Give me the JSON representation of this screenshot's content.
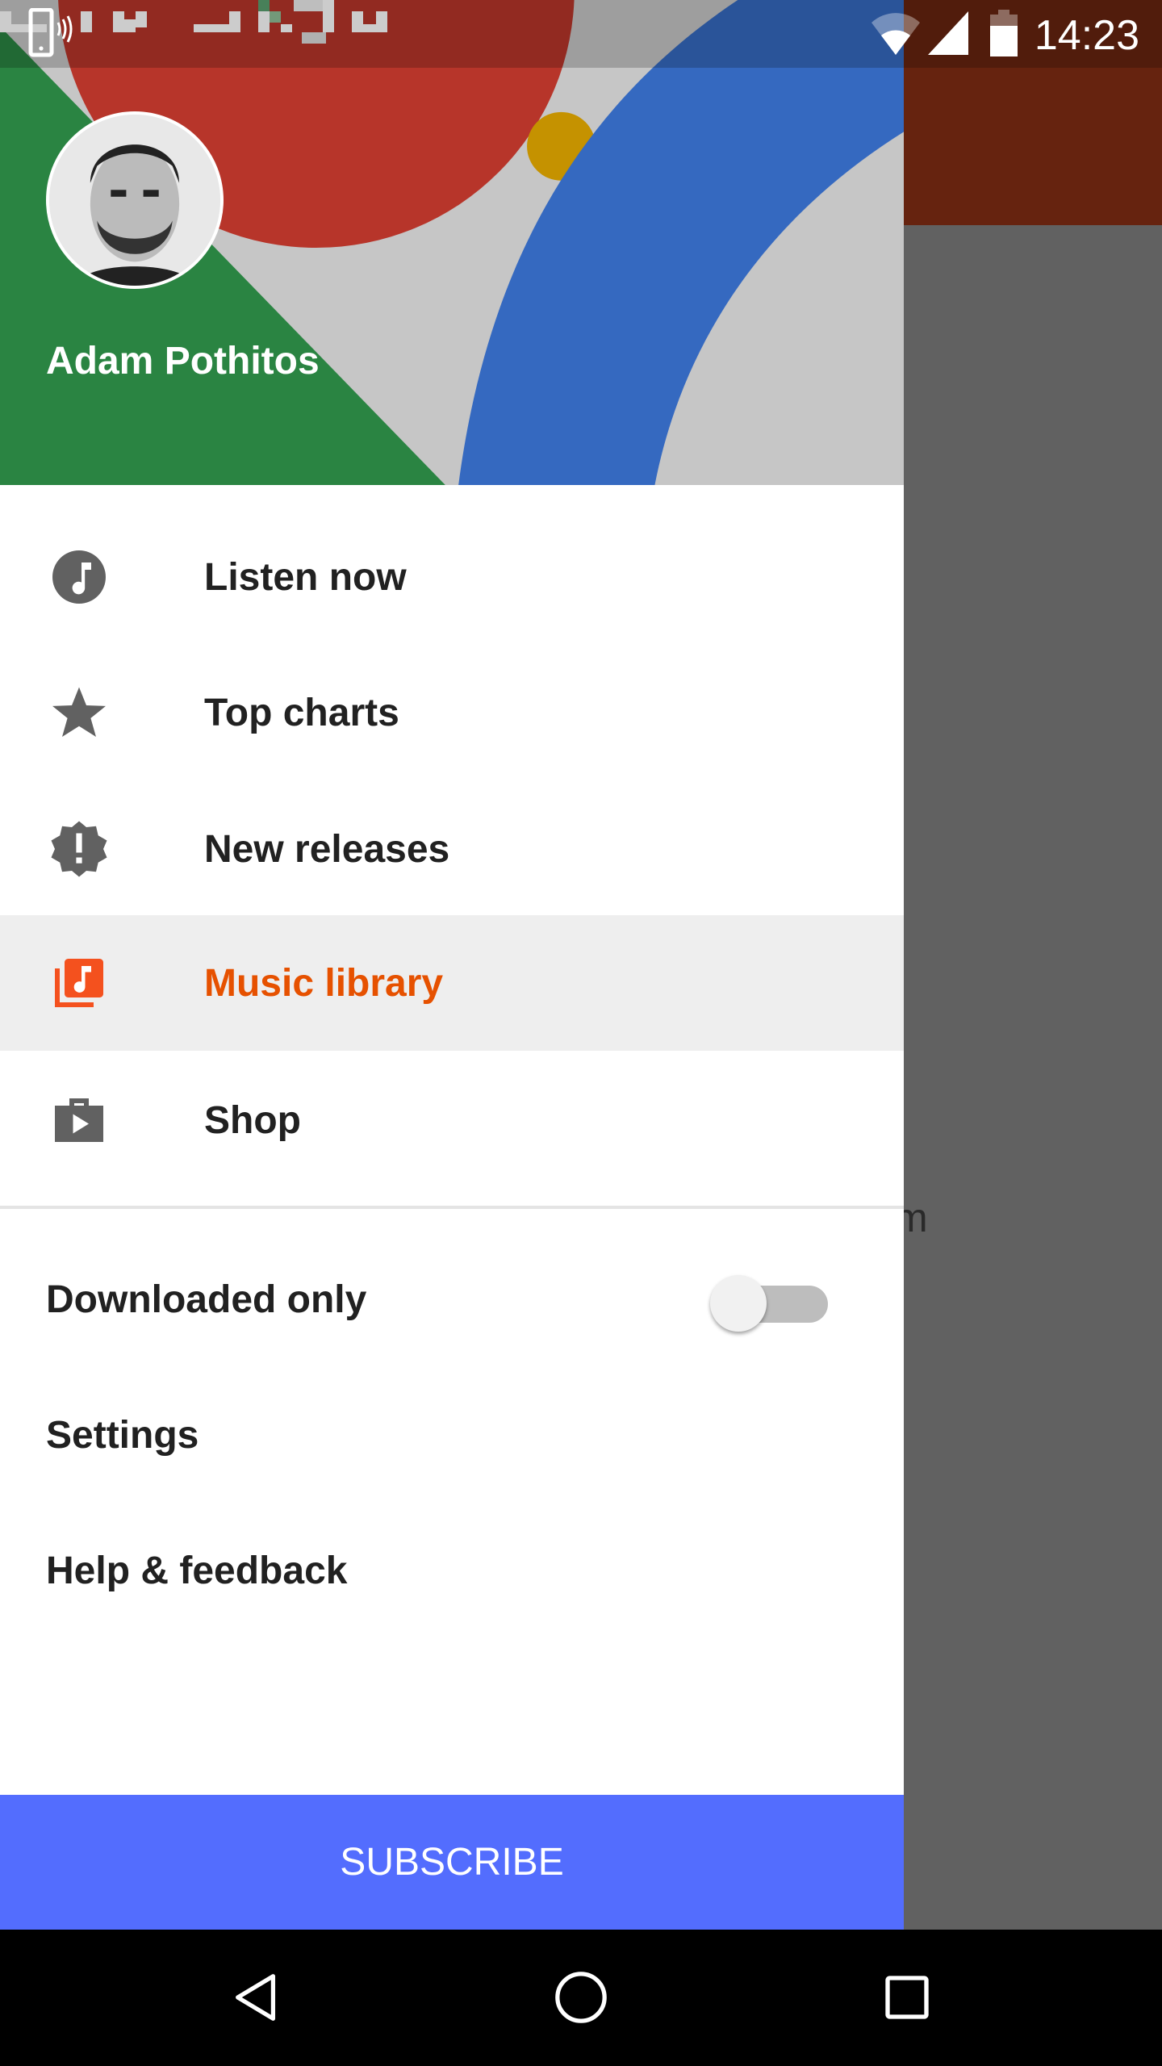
{
  "status_bar": {
    "time": "14:23",
    "icons": [
      "vibrate-phone-icon",
      "wifi-icon",
      "cell-signal-icon",
      "battery-icon"
    ]
  },
  "drawer": {
    "user": {
      "name": "Adam Pothitos"
    },
    "nav_items": [
      {
        "label": "Listen now",
        "icon": "music-note-circle-icon",
        "active": false
      },
      {
        "label": "Top charts",
        "icon": "star-icon",
        "active": false
      },
      {
        "label": "New releases",
        "icon": "new-releases-badge-icon",
        "active": false
      },
      {
        "label": "Music library",
        "icon": "library-music-icon",
        "active": true
      },
      {
        "label": "Shop",
        "icon": "shop-bag-icon",
        "active": false
      }
    ],
    "options": {
      "downloaded_only": {
        "label": "Downloaded only",
        "enabled": false
      },
      "settings": "Settings",
      "help": "Help & feedback"
    },
    "subscribe_label": "SUBSCRIBE"
  },
  "background_peek_text": "m",
  "colors": {
    "accent": "#e65100",
    "subscribe": "#536dfe",
    "icon_grey": "#616161"
  }
}
